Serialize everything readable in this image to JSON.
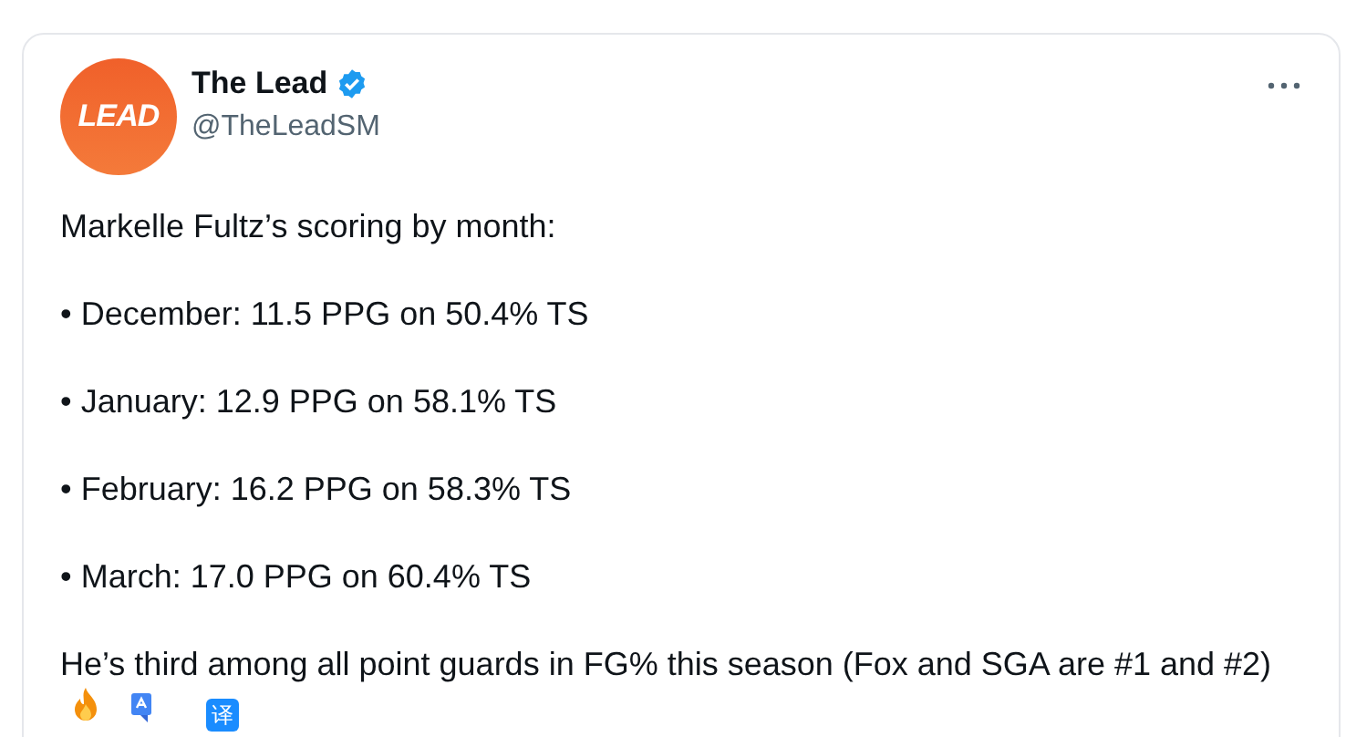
{
  "author": {
    "logo_text": "LEAD",
    "name": "The Lead",
    "verified": true,
    "handle": "@TheLeadSM"
  },
  "intro": "Markelle Fultz’s scoring by month:",
  "bullets": [
    {
      "marker": "•",
      "text": "December: 11.5 PPG on 50.4% TS"
    },
    {
      "marker": "•",
      "text": "January: 12.9 PPG on 58.1% TS"
    },
    {
      "marker": "•",
      "text": "February: 16.2 PPG on 58.3% TS"
    },
    {
      "marker": "•",
      "text": "March: 17.0 PPG on 60.4% TS"
    }
  ],
  "closing": "He’s third among all point guards in FG% this season (Fox and SGA are #1 and #2)",
  "translate_badge": "译"
}
